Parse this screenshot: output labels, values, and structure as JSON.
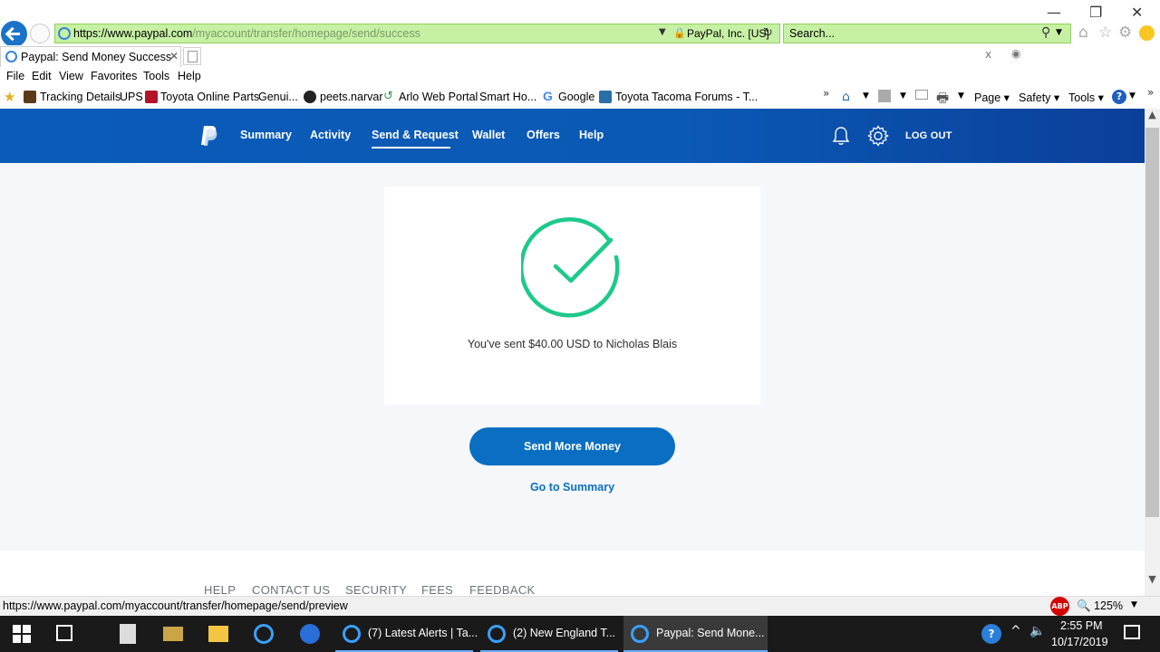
{
  "browser": {
    "url_prefix": "https://www.paypal.com",
    "url_path": "/myaccount/transfer/homepage/send/success",
    "cert_label": "PayPal, Inc. [US]",
    "search_placeholder": "Search...",
    "tab_title": "Paypal: Send Money Success",
    "menu": [
      "File",
      "Edit",
      "View",
      "Favorites",
      "Tools",
      "Help"
    ],
    "favorites": [
      "Tracking Details",
      "UPS",
      "Toyota Online Parts",
      "Genui...",
      "peets.narvar",
      "Arlo Web Portal",
      "Smart Ho...",
      "Google",
      "Toyota Tacoma Forums - T..."
    ],
    "commands": [
      "Page",
      "Safety",
      "Tools"
    ],
    "status_url": "https://www.paypal.com/myaccount/transfer/homepage/send/preview",
    "zoom": "125%"
  },
  "paypal": {
    "nav": [
      "Summary",
      "Activity",
      "Send & Request",
      "Wallet",
      "Offers",
      "Help"
    ],
    "logout": "LOG OUT",
    "message": "You've sent $40.00 USD to Nicholas Blais",
    "send_more": "Send More Money",
    "go_summary": "Go to Summary",
    "footer": [
      "HELP",
      "CONTACT US",
      "SECURITY",
      "FEES",
      "FEEDBACK"
    ],
    "colors": {
      "header": "#0b5bb8",
      "button": "#0a6fc2",
      "check": "#1ec98c"
    }
  },
  "taskbar": {
    "tasks": [
      "(7) Latest Alerts | Ta...",
      "(2) New England T...",
      "Paypal: Send Mone..."
    ],
    "time": "2:55 PM",
    "date": "10/17/2019"
  }
}
